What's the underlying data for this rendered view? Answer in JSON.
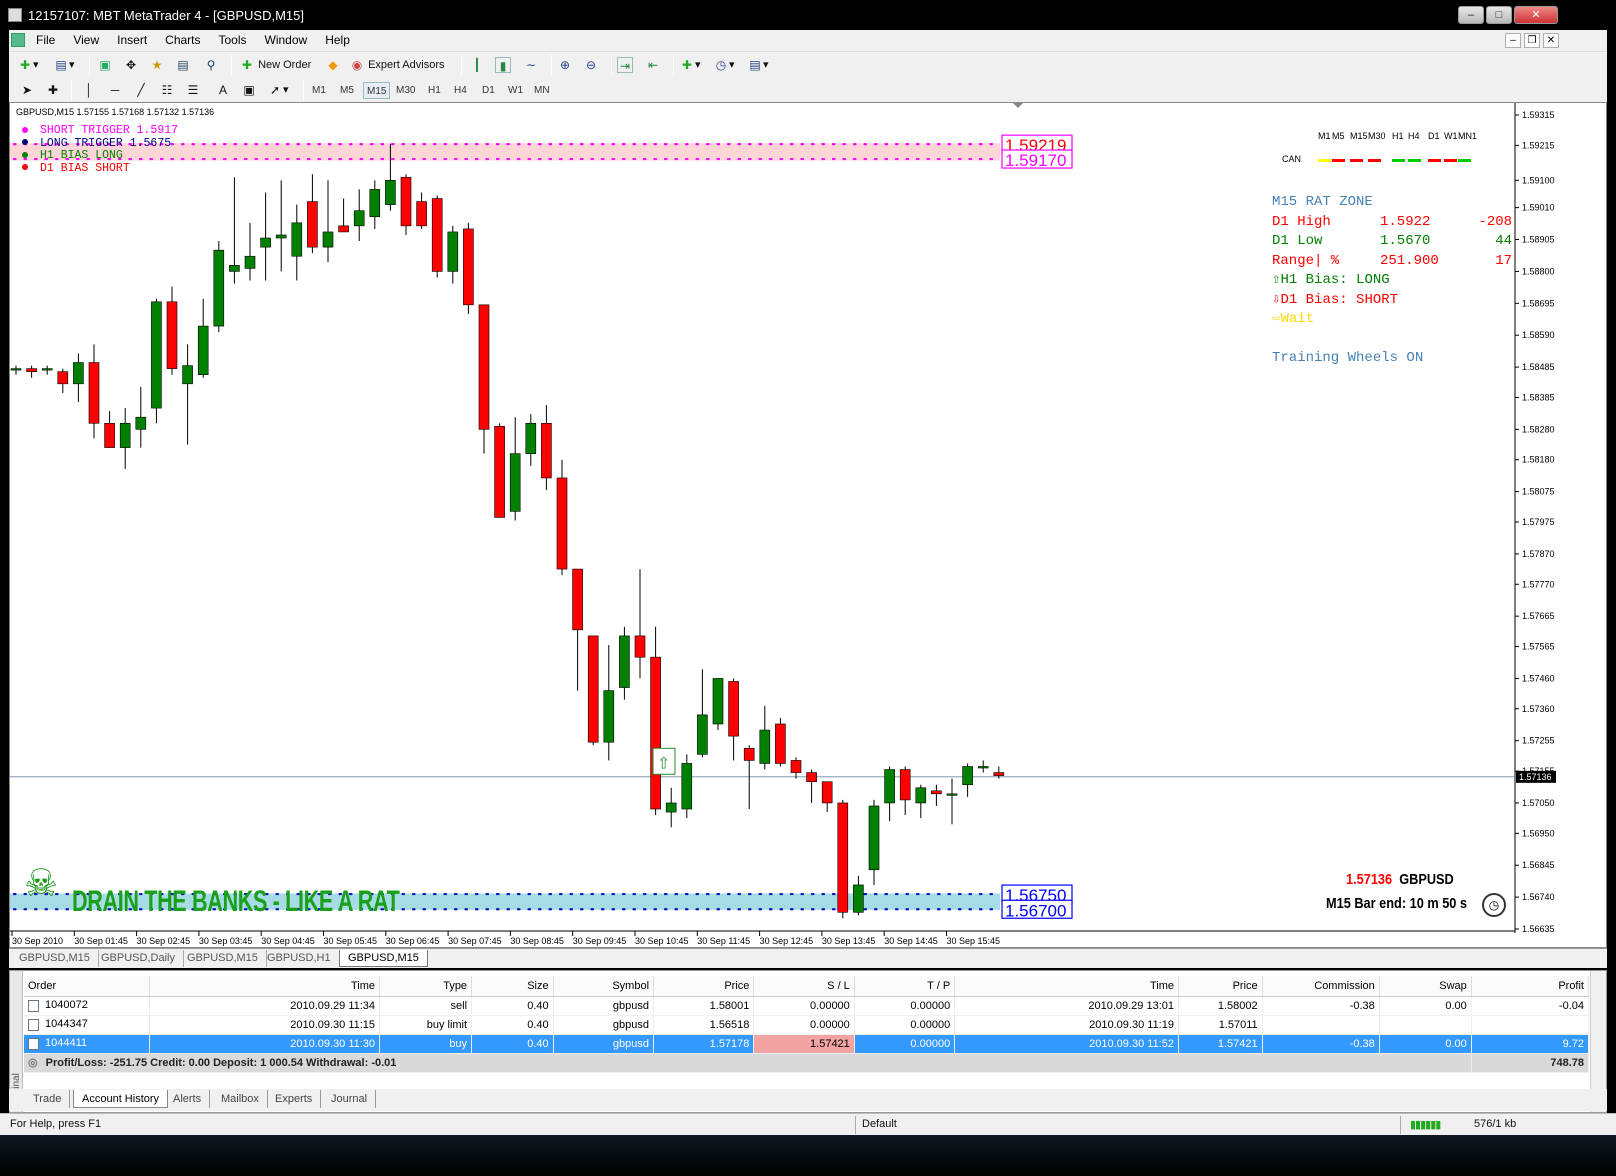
{
  "window": {
    "title": "12157107: MBT MetaTrader 4 - [GBPUSD,M15]"
  },
  "menu": [
    "File",
    "View",
    "Insert",
    "Charts",
    "Tools",
    "Window",
    "Help"
  ],
  "toolbar": {
    "new_order": "New Order",
    "expert_advisors": "Expert Advisors"
  },
  "timeframes": [
    "M1",
    "M5",
    "M15",
    "M30",
    "H1",
    "H4",
    "D1",
    "W1",
    "MN"
  ],
  "selected_timeframe": "M15",
  "chart": {
    "header": "GBPUSD,M15  1.57155 1.57168 1.57132 1.57136",
    "legend": [
      {
        "text": "SHORT TRIGGER 1.5917",
        "color": "#ff00ff"
      },
      {
        "text": "LONG TRIGGER  1.5675",
        "color": "#000080"
      },
      {
        "text": "H1 BIAS LONG",
        "color": "#008000"
      },
      {
        "text": "D1 BIAS SHORT",
        "color": "#ff0000"
      }
    ],
    "level_labels": {
      "upper1": "1.59219",
      "upper2": "1.59170",
      "lower1": "1.56750",
      "lower2": "1.56700"
    },
    "mtf": {
      "labels": [
        "M1",
        "M5",
        "M15",
        "M30",
        "H1",
        "H4",
        "D1",
        "W1",
        "MN1"
      ],
      "row_label": "CAN",
      "colors": [
        "#ffff00",
        "#ff0000",
        "#ff0000",
        "#ff0000",
        "#00cc00",
        "#00cc00",
        "#ff0000",
        "#ff0000",
        "#00cc00"
      ]
    },
    "rat_zone": {
      "title": "M15 RAT ZONE",
      "rows": [
        {
          "label": "D1 High",
          "value": "1.5922",
          "extra": "-208",
          "color": "#ff0000"
        },
        {
          "label": "D1 Low",
          "value": "1.5670",
          "extra": "44",
          "color": "#008000"
        },
        {
          "label": "Range| %",
          "value": "251.900",
          "extra": "17",
          "color": "#ff0000"
        }
      ],
      "h1_bias": "H1 Bias: LONG",
      "d1_bias": "D1 Bias: SHORT",
      "wait": "Wait",
      "training": "Training Wheels ON"
    },
    "banner": "DRAIN THE BANKS - LIKE A RAT",
    "price_info": {
      "price": "1.57136",
      "symbol": "GBPUSD",
      "bar_end": "M15 Bar end: 10 m 50 s"
    },
    "current_price_label": "1.57136",
    "y_axis": {
      "min": 1.56635,
      "max": 1.59315,
      "labels": [
        "1.59315",
        "1.59215",
        "1.59100",
        "1.59010",
        "1.58905",
        "1.58800",
        "1.58695",
        "1.58590",
        "1.58485",
        "1.58385",
        "1.58280",
        "1.58180",
        "1.58075",
        "1.57975",
        "1.57870",
        "1.57770",
        "1.57665",
        "1.57565",
        "1.57460",
        "1.57360",
        "1.57255",
        "1.57155",
        "1.57050",
        "1.56950",
        "1.56845",
        "1.56740",
        "1.56635"
      ]
    },
    "x_axis": [
      "30 Sep 2010",
      "30 Sep 01:45",
      "30 Sep 02:45",
      "30 Sep 03:45",
      "30 Sep 04:45",
      "30 Sep 05:45",
      "30 Sep 06:45",
      "30 Sep 07:45",
      "30 Sep 08:45",
      "30 Sep 09:45",
      "30 Sep 10:45",
      "30 Sep 11:45",
      "30 Sep 12:45",
      "30 Sep 13:45",
      "30 Sep 14:45",
      "30 Sep 15:45"
    ],
    "colors": {
      "bull": "#008000",
      "bear": "#ff0000"
    }
  },
  "chart_data": {
    "type": "candlestick",
    "symbol": "GBPUSD",
    "timeframe": "M15",
    "ylim": [
      1.56635,
      1.59315
    ],
    "candles": [
      {
        "o": 1.5848,
        "h": 1.5849,
        "l": 1.5846,
        "c": 1.5848
      },
      {
        "o": 1.5848,
        "h": 1.5849,
        "l": 1.5845,
        "c": 1.5847
      },
      {
        "o": 1.5848,
        "h": 1.5849,
        "l": 1.5846,
        "c": 1.5848
      },
      {
        "o": 1.5847,
        "h": 1.5848,
        "l": 1.584,
        "c": 1.5843
      },
      {
        "o": 1.5843,
        "h": 1.5853,
        "l": 1.5837,
        "c": 1.585
      },
      {
        "o": 1.585,
        "h": 1.5856,
        "l": 1.5825,
        "c": 1.583
      },
      {
        "o": 1.583,
        "h": 1.5834,
        "l": 1.5822,
        "c": 1.5822
      },
      {
        "o": 1.5822,
        "h": 1.5835,
        "l": 1.5815,
        "c": 1.583
      },
      {
        "o": 1.5828,
        "h": 1.5842,
        "l": 1.5822,
        "c": 1.5832
      },
      {
        "o": 1.5835,
        "h": 1.5871,
        "l": 1.583,
        "c": 1.587
      },
      {
        "o": 1.587,
        "h": 1.5875,
        "l": 1.5846,
        "c": 1.5848
      },
      {
        "o": 1.5843,
        "h": 1.5856,
        "l": 1.5823,
        "c": 1.5849
      },
      {
        "o": 1.5846,
        "h": 1.5871,
        "l": 1.5845,
        "c": 1.5862
      },
      {
        "o": 1.5862,
        "h": 1.589,
        "l": 1.586,
        "c": 1.5887
      },
      {
        "o": 1.588,
        "h": 1.5911,
        "l": 1.5876,
        "c": 1.5882
      },
      {
        "o": 1.5881,
        "h": 1.5896,
        "l": 1.5877,
        "c": 1.5885
      },
      {
        "o": 1.5888,
        "h": 1.5906,
        "l": 1.5877,
        "c": 1.5891
      },
      {
        "o": 1.5891,
        "h": 1.591,
        "l": 1.588,
        "c": 1.5892
      },
      {
        "o": 1.5885,
        "h": 1.5902,
        "l": 1.5877,
        "c": 1.5896
      },
      {
        "o": 1.5903,
        "h": 1.5912,
        "l": 1.5886,
        "c": 1.5888
      },
      {
        "o": 1.5888,
        "h": 1.591,
        "l": 1.5883,
        "c": 1.5893
      },
      {
        "o": 1.5895,
        "h": 1.5904,
        "l": 1.5893,
        "c": 1.5893
      },
      {
        "o": 1.5895,
        "h": 1.5907,
        "l": 1.589,
        "c": 1.59
      },
      {
        "o": 1.5898,
        "h": 1.591,
        "l": 1.5894,
        "c": 1.5907
      },
      {
        "o": 1.5902,
        "h": 1.5922,
        "l": 1.59,
        "c": 1.591
      },
      {
        "o": 1.5911,
        "h": 1.5912,
        "l": 1.5892,
        "c": 1.5895
      },
      {
        "o": 1.5903,
        "h": 1.5906,
        "l": 1.5894,
        "c": 1.5895
      },
      {
        "o": 1.5904,
        "h": 1.5905,
        "l": 1.5878,
        "c": 1.588
      },
      {
        "o": 1.588,
        "h": 1.5895,
        "l": 1.5876,
        "c": 1.5893
      },
      {
        "o": 1.5894,
        "h": 1.5896,
        "l": 1.5866,
        "c": 1.5869
      },
      {
        "o": 1.5869,
        "h": 1.5869,
        "l": 1.582,
        "c": 1.5828
      },
      {
        "o": 1.5829,
        "h": 1.583,
        "l": 1.5799,
        "c": 1.5799
      },
      {
        "o": 1.5801,
        "h": 1.5832,
        "l": 1.5798,
        "c": 1.582
      },
      {
        "o": 1.582,
        "h": 1.5833,
        "l": 1.5816,
        "c": 1.583
      },
      {
        "o": 1.583,
        "h": 1.5836,
        "l": 1.5808,
        "c": 1.5812
      },
      {
        "o": 1.5812,
        "h": 1.5818,
        "l": 1.578,
        "c": 1.5782
      },
      {
        "o": 1.5782,
        "h": 1.5782,
        "l": 1.5742,
        "c": 1.5762
      },
      {
        "o": 1.576,
        "h": 1.576,
        "l": 1.5724,
        "c": 1.5725
      },
      {
        "o": 1.5725,
        "h": 1.5757,
        "l": 1.5719,
        "c": 1.5742
      },
      {
        "o": 1.5743,
        "h": 1.5763,
        "l": 1.5739,
        "c": 1.576
      },
      {
        "o": 1.576,
        "h": 1.5782,
        "l": 1.5746,
        "c": 1.5753
      },
      {
        "o": 1.5753,
        "h": 1.5763,
        "l": 1.5701,
        "c": 1.5703
      },
      {
        "o": 1.5702,
        "h": 1.571,
        "l": 1.5697,
        "c": 1.5705
      },
      {
        "o": 1.5703,
        "h": 1.5721,
        "l": 1.57,
        "c": 1.5718
      },
      {
        "o": 1.5721,
        "h": 1.5749,
        "l": 1.572,
        "c": 1.5734
      },
      {
        "o": 1.5731,
        "h": 1.5746,
        "l": 1.5729,
        "c": 1.5746
      },
      {
        "o": 1.5745,
        "h": 1.5746,
        "l": 1.5719,
        "c": 1.5727
      },
      {
        "o": 1.5723,
        "h": 1.5724,
        "l": 1.5703,
        "c": 1.5719
      },
      {
        "o": 1.5718,
        "h": 1.5737,
        "l": 1.5716,
        "c": 1.5729
      },
      {
        "o": 1.5731,
        "h": 1.5733,
        "l": 1.5717,
        "c": 1.5718
      },
      {
        "o": 1.5719,
        "h": 1.572,
        "l": 1.5713,
        "c": 1.5715
      },
      {
        "o": 1.5715,
        "h": 1.5716,
        "l": 1.5705,
        "c": 1.5712
      },
      {
        "o": 1.5712,
        "h": 1.5712,
        "l": 1.5702,
        "c": 1.5705
      },
      {
        "o": 1.5705,
        "h": 1.5706,
        "l": 1.5667,
        "c": 1.5669
      },
      {
        "o": 1.5669,
        "h": 1.5681,
        "l": 1.5668,
        "c": 1.5678
      },
      {
        "o": 1.5683,
        "h": 1.5706,
        "l": 1.5678,
        "c": 1.5704
      },
      {
        "o": 1.5705,
        "h": 1.5717,
        "l": 1.5699,
        "c": 1.5716
      },
      {
        "o": 1.5716,
        "h": 1.5717,
        "l": 1.5701,
        "c": 1.5706
      },
      {
        "o": 1.5705,
        "h": 1.5711,
        "l": 1.57,
        "c": 1.571
      },
      {
        "o": 1.5709,
        "h": 1.5711,
        "l": 1.5704,
        "c": 1.5708
      },
      {
        "o": 1.5708,
        "h": 1.5713,
        "l": 1.5698,
        "c": 1.5708
      },
      {
        "o": 1.5711,
        "h": 1.5718,
        "l": 1.5707,
        "c": 1.5717
      },
      {
        "o": 1.5717,
        "h": 1.5719,
        "l": 1.5715,
        "c": 1.5717
      },
      {
        "o": 1.5715,
        "h": 1.5717,
        "l": 1.5713,
        "c": 1.5714
      }
    ]
  },
  "chart_tabs": [
    "GBPUSD,M15",
    "GBPUSD,Daily",
    "GBPUSD,M15",
    "GBPUSD,H1",
    "GBPUSD,M15"
  ],
  "active_chart_tab": 4,
  "terminal": {
    "side_label": "Terminal",
    "columns": [
      "Order",
      "Time",
      "Type",
      "Size",
      "Symbol",
      "Price",
      "S / L",
      "T / P",
      "Time",
      "Price",
      "Commission",
      "Swap",
      "Profit"
    ],
    "rows": [
      [
        "1040072",
        "2010.09.29 11:34",
        "sell",
        "0.40",
        "gbpusd",
        "1.58001",
        "0.00000",
        "0.00000",
        "2010.09.29 13:01",
        "1.58002",
        "-0.38",
        "0.00",
        "-0.04"
      ],
      [
        "1044347",
        "2010.09.30 11:15",
        "buy limit",
        "0.40",
        "gbpusd",
        "1.56518",
        "0.00000",
        "0.00000",
        "2010.09.30 11:19",
        "1.57011",
        "",
        "",
        ""
      ],
      [
        "1044411",
        "2010.09.30 11:30",
        "buy",
        "0.40",
        "gbpusd",
        "1.57178",
        "1.57421",
        "0.00000",
        "2010.09.30 11:52",
        "1.57421",
        "-0.38",
        "0.00",
        "9.72"
      ]
    ],
    "summary": "Profit/Loss: -251.75  Credit: 0.00  Deposit: 1 000.54  Withdrawal: -0.01",
    "summary_total": "748.78",
    "tabs": [
      "Trade",
      "Account History",
      "Alerts",
      "Mailbox",
      "Experts",
      "Journal"
    ],
    "active_tab": 1
  },
  "status": {
    "help": "For Help, press F1",
    "profile": "Default",
    "traffic": "576/1 kb"
  }
}
